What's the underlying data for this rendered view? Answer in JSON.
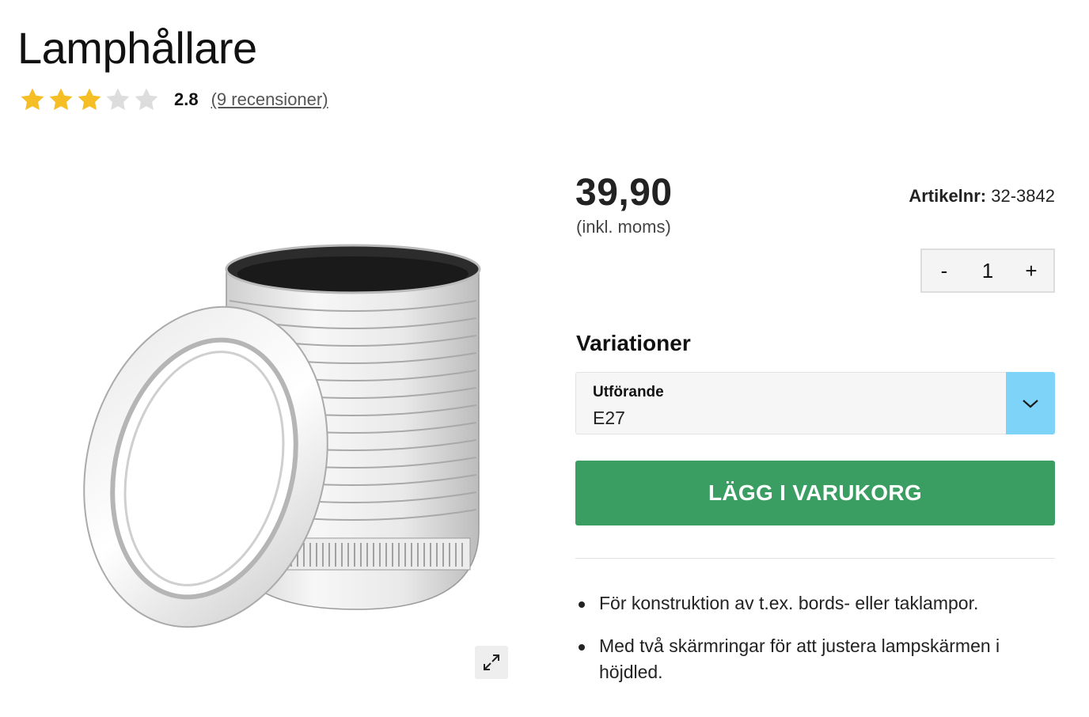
{
  "product": {
    "title": "Lamphållare",
    "rating": {
      "value": "2.8",
      "stars_filled": 3,
      "stars_total": 5,
      "reviews_label": "(9 recensioner)",
      "star_color": "#f5be25",
      "star_empty_color": "#dddddd"
    },
    "price": "39,90",
    "price_note": "(inkl. moms)",
    "sku_label": "Artikelnr:",
    "sku_value": "32-3842",
    "image_icon": "expand-icon"
  },
  "quantity": {
    "decrement_label": "-",
    "value": "1",
    "increment_label": "+"
  },
  "variations": {
    "heading": "Variationer",
    "select_label": "Utförande",
    "selected_value": "E27",
    "arrow_color": "#7dd4f8"
  },
  "cart": {
    "button_label": "LÄGG I VARUKORG",
    "button_color": "#3a9e62"
  },
  "features": [
    "För konstruktion av t.ex. bords- eller taklampor.",
    "Med två skärmringar för att justera lampskärmen i höjdled."
  ]
}
